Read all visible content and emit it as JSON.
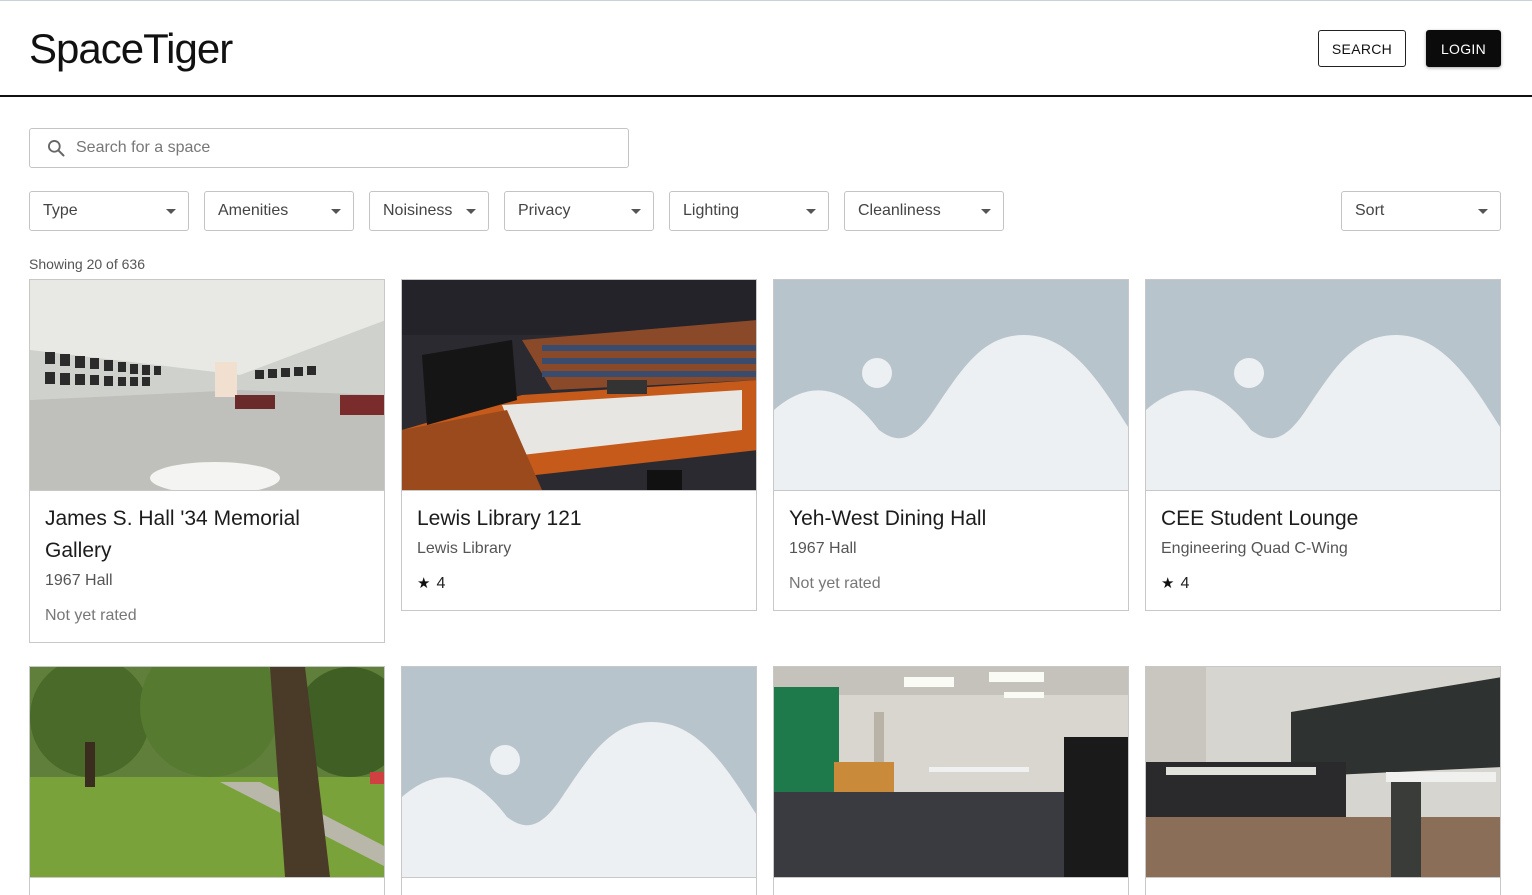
{
  "app": {
    "logo": "SpaceTiger"
  },
  "header": {
    "search_label": "SEARCH",
    "login_label": "LOGIN"
  },
  "search": {
    "placeholder": "Search for a space",
    "value": ""
  },
  "filters": {
    "type": "Type",
    "amenities": "Amenities",
    "noisiness": "Noisiness",
    "privacy": "Privacy",
    "lighting": "Lighting",
    "cleanliness": "Cleanliness",
    "sort": "Sort"
  },
  "results": {
    "count_text": "Showing 20 of 636"
  },
  "cards": [
    {
      "title": "James S. Hall '34 Memorial Gallery",
      "location": "1967 Hall",
      "rating": "Not yet rated",
      "image": "gallery-photo"
    },
    {
      "title": "Lewis Library 121",
      "location": "Lewis Library",
      "rating": "4",
      "image": "lecture-hall-photo"
    },
    {
      "title": "Yeh-West Dining Hall",
      "location": "1967 Hall",
      "rating": "Not yet rated",
      "image": "placeholder"
    },
    {
      "title": "CEE Student Lounge",
      "location": "Engineering Quad C-Wing",
      "rating": "4",
      "image": "placeholder"
    },
    {
      "title": "",
      "location": "",
      "rating": "",
      "image": "lawn-photo"
    },
    {
      "title": "",
      "location": "",
      "rating": "",
      "image": "placeholder"
    },
    {
      "title": "",
      "location": "",
      "rating": "",
      "image": "room-photo"
    },
    {
      "title": "",
      "location": "",
      "rating": "",
      "image": "classroom-photo"
    }
  ],
  "colors": {
    "brand": "#111111",
    "placeholder_bg": "#b8c4cc",
    "placeholder_fg": "#edf0f2"
  }
}
